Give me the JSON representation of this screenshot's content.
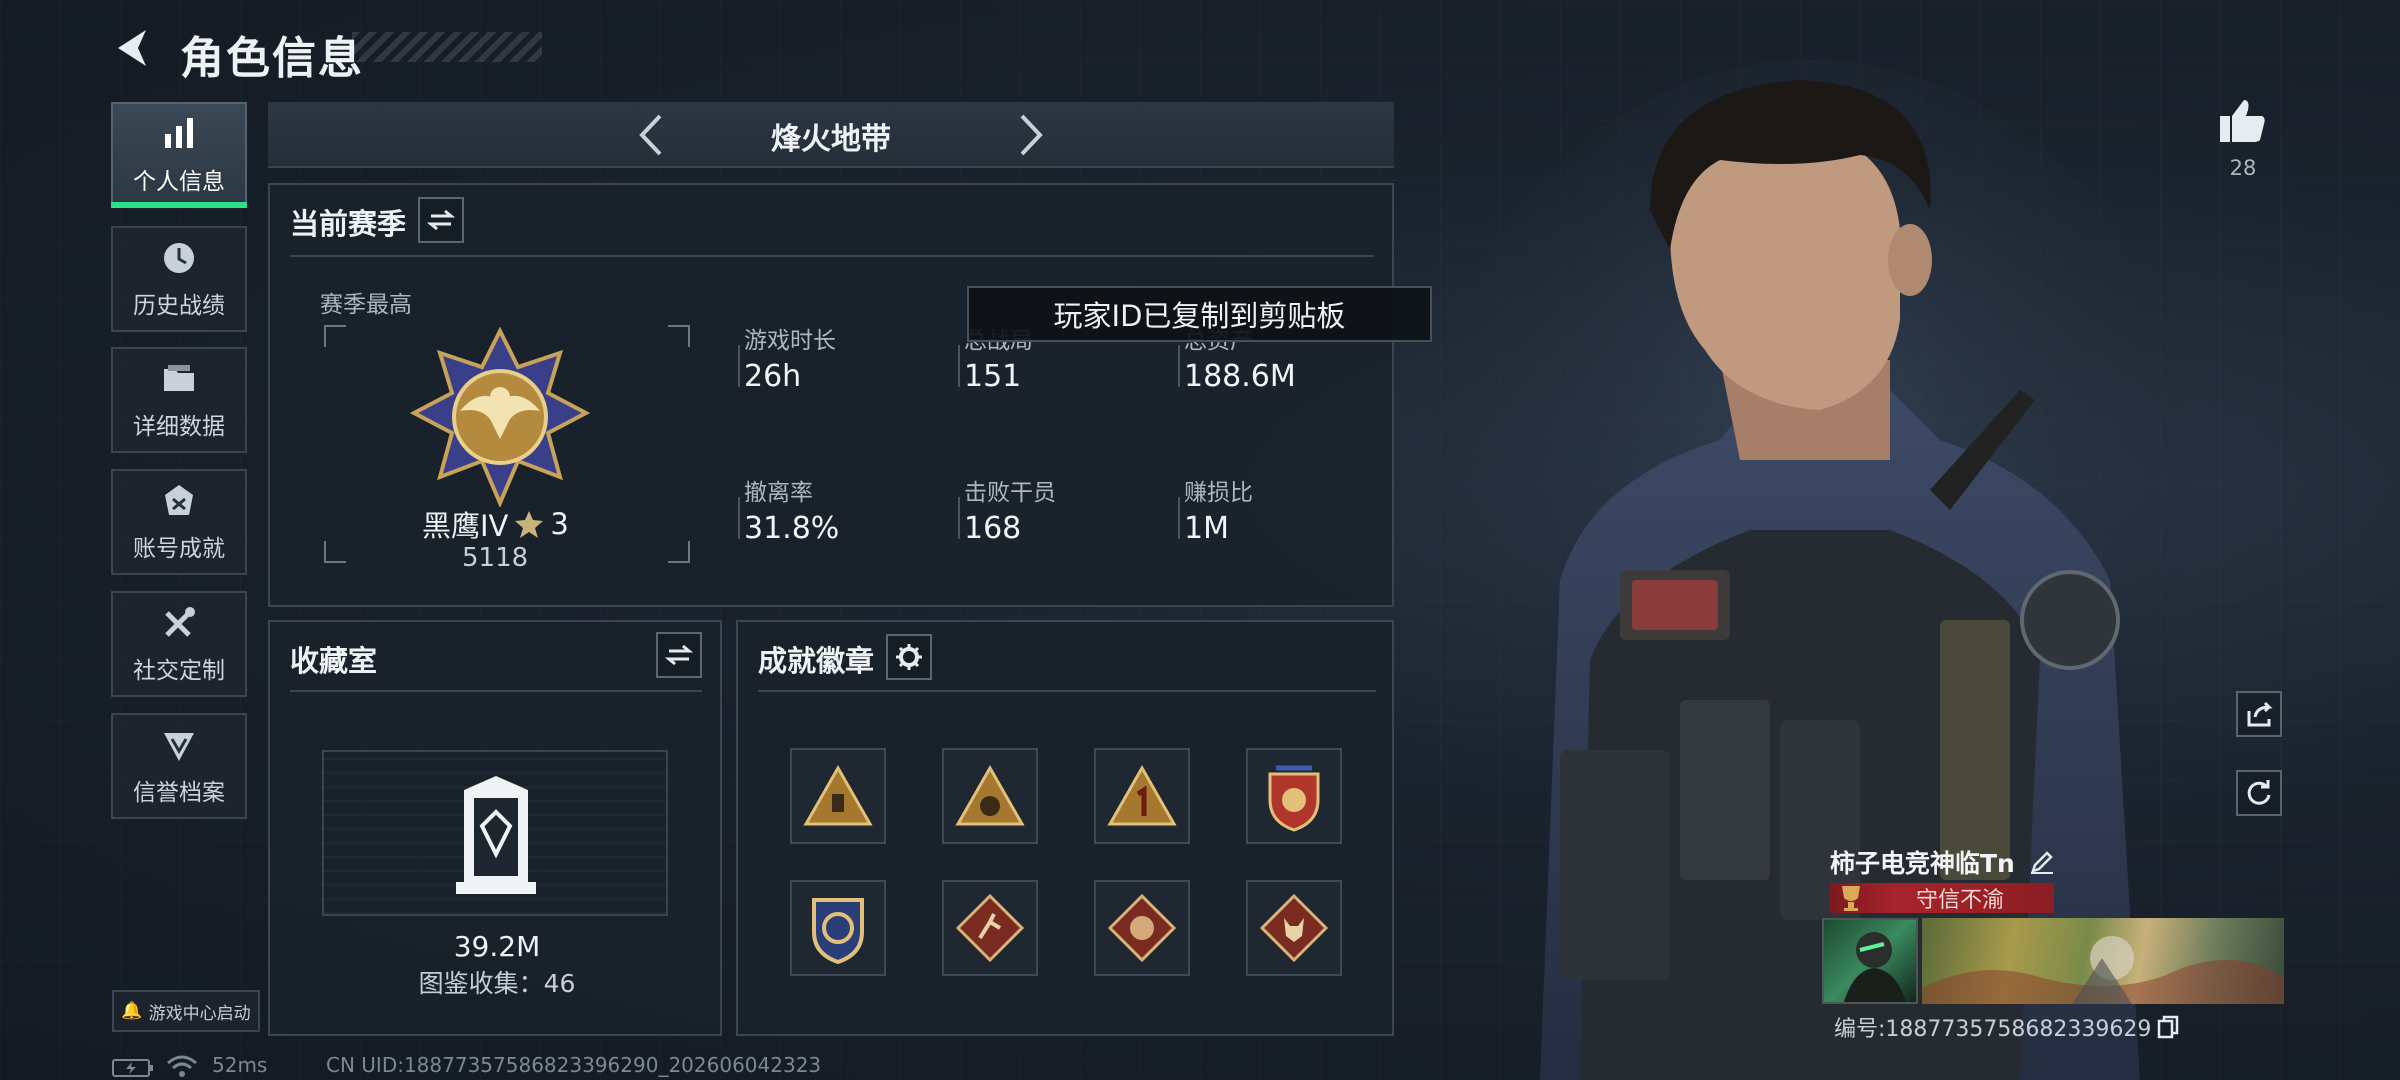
{
  "header": {
    "title": "角色信息"
  },
  "sidebar": {
    "items": [
      {
        "label": "个人信息",
        "icon": "bar-chart-icon",
        "active": true
      },
      {
        "label": "历史战绩",
        "icon": "history-clock-icon"
      },
      {
        "label": "详细数据",
        "icon": "folder-icon"
      },
      {
        "label": "账号成就",
        "icon": "achievement-icon"
      },
      {
        "label": "社交定制",
        "icon": "tools-icon"
      },
      {
        "label": "信誉档案",
        "icon": "reputation-icon"
      }
    ],
    "launch_label": "游戏中心启动"
  },
  "mode_bar": {
    "mode_name": "烽火地带"
  },
  "season": {
    "title": "当前赛季",
    "best_label": "赛季最高",
    "rank_name": "黑鹰IV",
    "rank_stars": "3",
    "rank_score": "5118",
    "stats": [
      {
        "label": "游戏时长",
        "value": "26h"
      },
      {
        "label": "总战局",
        "value": "151"
      },
      {
        "label": "总资产",
        "value": "188.6M"
      },
      {
        "label": "撤离率",
        "value": "31.8%"
      },
      {
        "label": "击败干员",
        "value": "168"
      },
      {
        "label": "赚损比",
        "value": "1M"
      }
    ]
  },
  "toast": {
    "text": "玩家ID已复制到剪贴板"
  },
  "collection": {
    "title": "收藏室",
    "value": "39.2M",
    "catalog_label": "图鉴收集：46"
  },
  "achievements": {
    "title": "成就徽章"
  },
  "player": {
    "likes": "28",
    "name": "柿子电竞神临Tn",
    "title_tag": "守信不渝",
    "id_label": "编号:1887735758682339629"
  },
  "status_bar": {
    "ping": "52ms",
    "uid": "CN UID:18877357586823396290_202606042323"
  },
  "colors": {
    "accent": "#2fe08a",
    "title_tag_bg": "#a8242b"
  }
}
